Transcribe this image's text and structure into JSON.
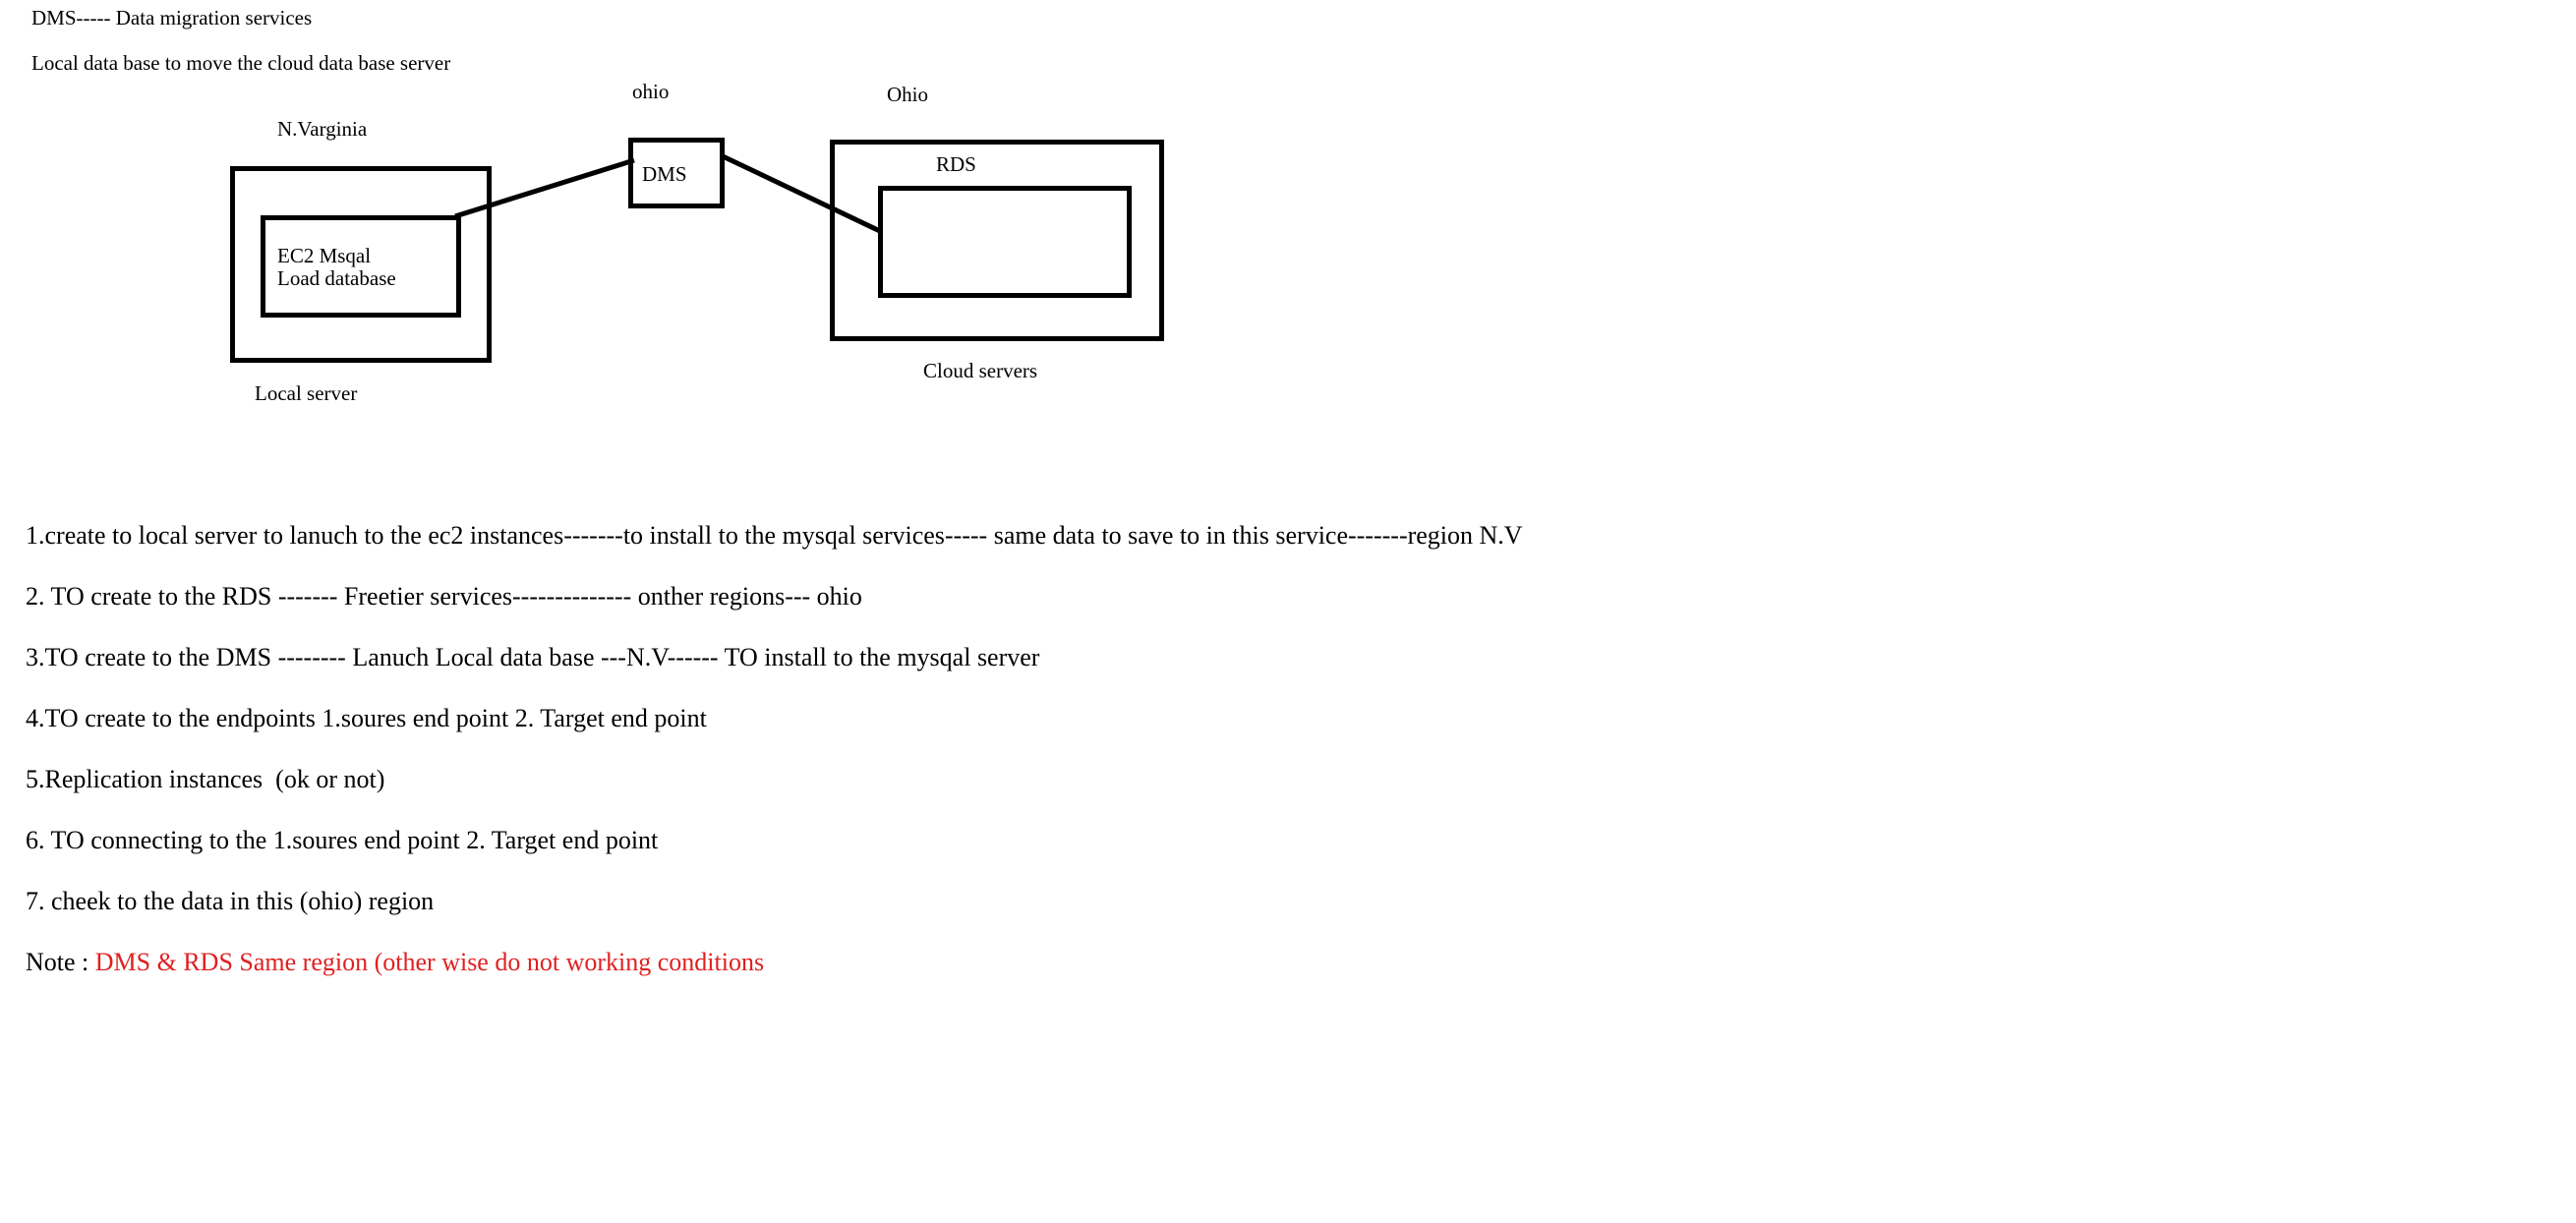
{
  "header": {
    "title": "DMS----- Data migration services",
    "subtitle": "Local data base to move the cloud data base server"
  },
  "diagram": {
    "labels": {
      "region_nv": "N.Varginia",
      "region_ohio_dms": "ohio",
      "region_ohio_rds": "Ohio",
      "ec2_line1": "EC2 Msqal",
      "ec2_line2": "Load database",
      "dms": "DMS",
      "rds": "RDS",
      "local_server": "Local server",
      "cloud_servers": "Cloud servers"
    }
  },
  "steps": [
    "1.create to local server to lanuch to the ec2 instances-------to install to the mysqal services----- same data to save to in this service-------region N.V",
    "2. TO create to the RDS ------- Freetier services-------------- onther regions--- ohio",
    "3.TO create to the DMS -------- Lanuch Local data base ---N.V------ TO install to the mysqal server",
    "4.TO create to the endpoints 1.soures end point 2. Target end point",
    "5.Replication instances  (ok or not)",
    "6. TO connecting to the 1.soures end point 2. Target end point",
    "7. cheek to the data in this (ohio) region"
  ],
  "note": {
    "prefix": "Note : ",
    "text": "DMS & RDS Same region (other wise do not working conditions",
    "color": "#e02020"
  }
}
